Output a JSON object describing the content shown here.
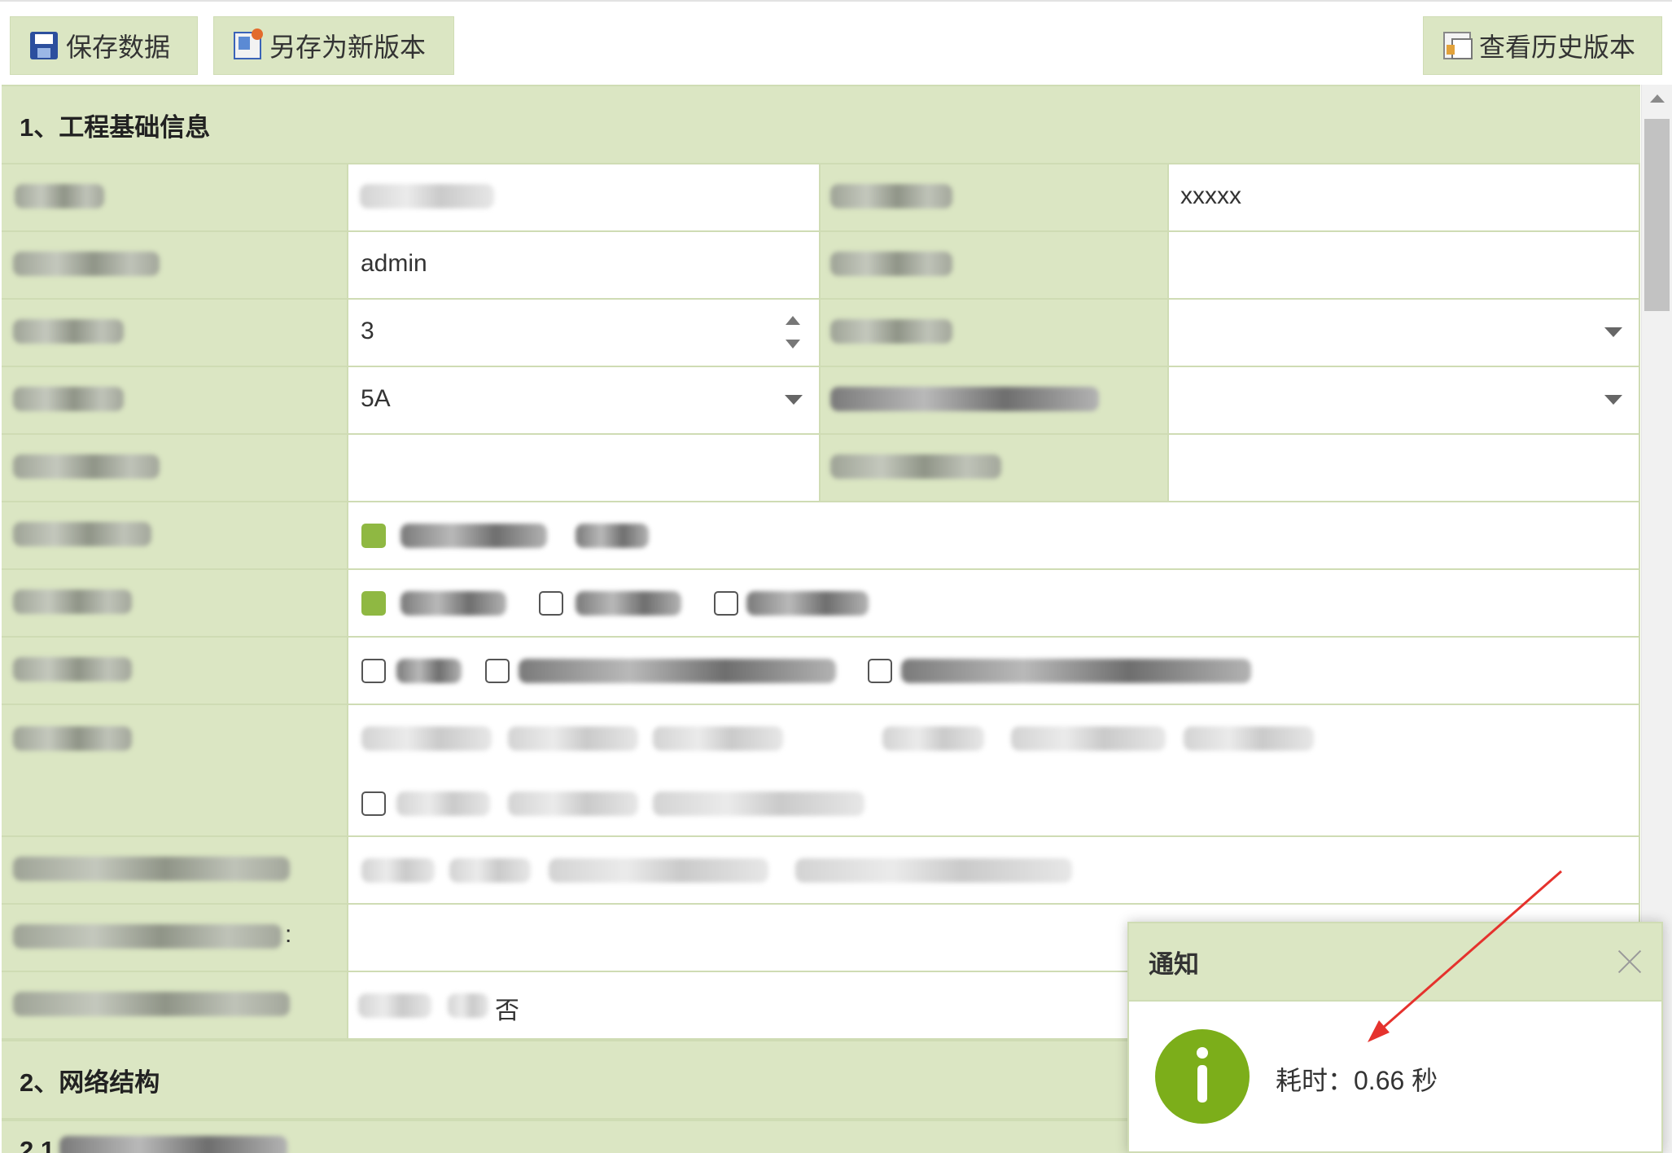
{
  "toolbar": {
    "save_label": "保存数据",
    "save_as_label": "另存为新版本",
    "history_label": "查看历史版本"
  },
  "sections": {
    "s1_title": "1、工程基础信息",
    "s2_title": "2、网络结构",
    "s21_prefix": "2.1 "
  },
  "fields": {
    "row1_right_value": "xxxxx",
    "row2_left_value": "admin",
    "row3_left_value": "3",
    "row4_left_value": "5A",
    "row10_tail_text": "否",
    "row11_colon": ":"
  },
  "notification": {
    "title": "通知",
    "message": "耗时：0.66 秒"
  },
  "colors": {
    "header_bg": "#dbe6c3",
    "border": "#cfdcb4",
    "accent_green": "#7cae1a",
    "annotation_arrow": "#e5322d"
  }
}
